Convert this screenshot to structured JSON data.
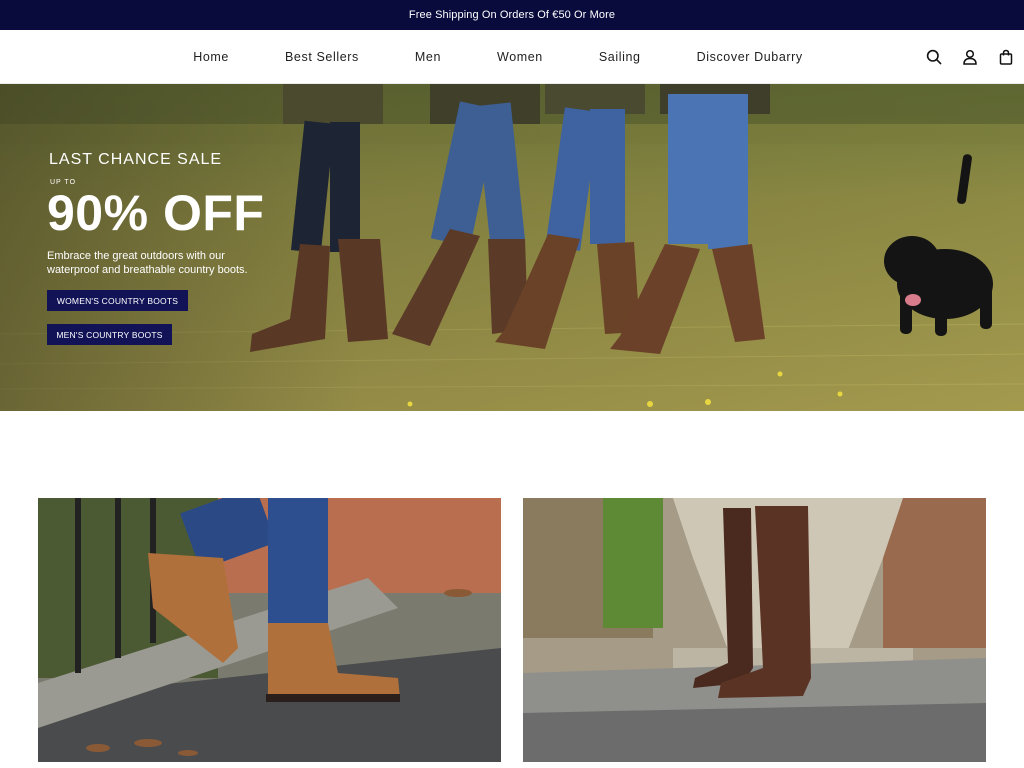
{
  "announcement": {
    "text": "Free Shipping On Orders Of €50 Or More"
  },
  "nav": {
    "items": [
      {
        "label": "Home"
      },
      {
        "label": "Best Sellers"
      },
      {
        "label": "Men"
      },
      {
        "label": "Women"
      },
      {
        "label": "Sailing"
      },
      {
        "label": "Discover Dubarry"
      }
    ]
  },
  "header_icons": [
    "search-icon",
    "account-icon",
    "bag-icon"
  ],
  "hero": {
    "kicker": "LAST CHANCE SALE",
    "upto": "UP TO",
    "headline": "90% OFF",
    "description": "Embrace the great outdoors with our waterproof and breathable country boots.",
    "cta_women": "WOMEN'S COUNTRY BOOTS",
    "cta_men": "MEN'S COUNTRY BOOTS"
  },
  "colors": {
    "announcement_bg": "#0a0b3d",
    "button_bg": "#121357"
  }
}
